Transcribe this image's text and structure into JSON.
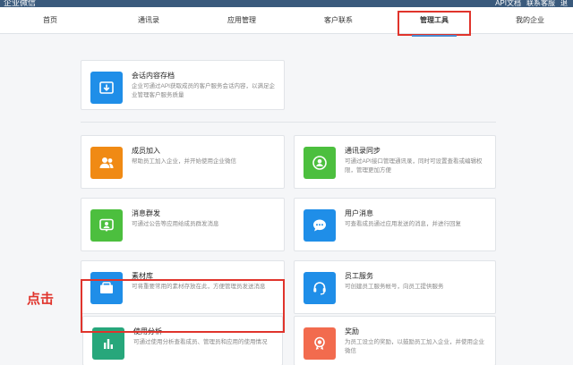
{
  "header": {
    "brand": "企业微信",
    "links": [
      "API文档",
      "联系客服",
      "退"
    ]
  },
  "nav": {
    "items": [
      {
        "label": "首页",
        "active": false
      },
      {
        "label": "通讯录",
        "active": false
      },
      {
        "label": "应用管理",
        "active": false
      },
      {
        "label": "客户联系",
        "active": false
      },
      {
        "label": "管理工具",
        "active": true
      },
      {
        "label": "我的企业",
        "active": false
      }
    ]
  },
  "cards": {
    "archive": {
      "title": "会话内容存档",
      "desc": "企业可通过API获取成员的客户服务会话内容，以满足企业管理客户服务质量"
    },
    "member_join": {
      "title": "成员加入",
      "desc": "帮助员工加入企业，并开始使用企业微信"
    },
    "contact_sync": {
      "title": "通讯录同步",
      "desc": "可通过API接口管理通讯录，同时可设置查看或编辑权限，管理更加方便"
    },
    "broadcast": {
      "title": "消息群发",
      "desc": "可通过公告等应用给成员群发消息"
    },
    "user_msg": {
      "title": "用户消息",
      "desc": "可查看成员通过应用发送的消息，并进行回复"
    },
    "library": {
      "title": "素材库",
      "desc": "可将重要常用的素材存放在此，方便管理员发送消息"
    },
    "staff_service": {
      "title": "员工服务",
      "desc": "可创建员工服务帐号，向员工提供服务"
    },
    "usage": {
      "title": "使用分析",
      "desc": "可通过使用分析查看成员、管理员和应用的使用情况"
    },
    "reward": {
      "title": "奖励",
      "desc": "为员工设立的奖励，以鼓励员工加入企业，并使用企业微信"
    }
  },
  "annotation": {
    "click_label": "点击"
  },
  "colors": {
    "topbar": "#3a5a7c",
    "orange": "#f08a14",
    "green": "#4cbf3e",
    "blue": "#1f8ee8",
    "teal": "#27a77b",
    "red_orange": "#f26b4e",
    "highlight": "#e0342c"
  }
}
